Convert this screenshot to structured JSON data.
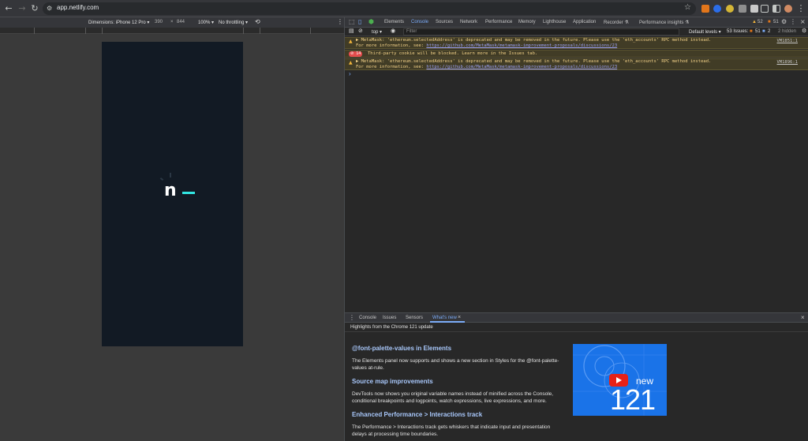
{
  "browser": {
    "url": "app.netlify.com"
  },
  "device_toolbar": {
    "dimensions": "Dimensions: iPhone 12 Pro ▾",
    "width": "390",
    "x": "×",
    "height": "844",
    "zoom": "100% ▾",
    "throttle": "No throttling ▾"
  },
  "devtools": {
    "tabs": [
      "Elements",
      "Console",
      "Sources",
      "Network",
      "Performance",
      "Memory",
      "Lighthouse",
      "Application",
      "Recorder ⚗",
      "Performance insights ⚗"
    ],
    "badges": {
      "warnings": "52",
      "issues": "51"
    },
    "console_toolbar": {
      "context": "top ▾",
      "filter_placeholder": "Filter",
      "levels": "Default levels ▾",
      "issues_label": "53 Issues:",
      "issues_warn": "51",
      "issues_info": "2",
      "hidden": "2 hidden"
    },
    "messages": [
      {
        "line1": "▶ MetaMask: 'ethereum.selectedAddress' is deprecated and may be removed in the future. Please use the 'eth_accounts' RPC method instead.",
        "line2_prefix": "For more information, see: ",
        "link": "https://github.com/MetaMask/metamask-improvement-proposals/discussions/23",
        "source": "VM1851:1"
      },
      {
        "count": "14",
        "line1": "Third-party cookie will be blocked. Learn more in the Issues tab."
      },
      {
        "line1": "▶ MetaMask: 'ethereum.selectedAddress' is deprecated and may be removed in the future. Please use the 'eth_accounts' RPC method instead.",
        "line2_prefix": "For more information, see: ",
        "link": "https://github.com/MetaMask/metamask-improvement-proposals/discussions/23",
        "source": "VM1896:1"
      }
    ],
    "prompt": "›"
  },
  "drawer": {
    "tabs": [
      "Console",
      "Issues",
      "Sensors",
      "What's new"
    ],
    "close": "×",
    "subtitle": "Highlights from the Chrome 121 update",
    "sections": [
      {
        "heading": "@font-palette-values in Elements",
        "body": "The Elements panel now supports and shows a new section in Styles for the @font-palette-values at-rule."
      },
      {
        "heading": "Source map improvements",
        "body": "DevTools now shows you original variable names instead of minified across the Console, conditional breakpoints and logpoints, watch expressions, live expressions, and more."
      },
      {
        "heading": "Enhanced Performance > Interactions track",
        "body": "The Performance > Interactions track gets whiskers that indicate input and presentation delays at processing time boundaries."
      }
    ],
    "promo": {
      "new": "new",
      "version": "121"
    }
  },
  "app": {
    "logo_letter": "n"
  },
  "colors": {
    "accent_link": "#7cacf8",
    "warning_bg": "#413c26",
    "logo_cyan": "#32e6e2",
    "phone_bg": "#121a24",
    "promo_bg": "#1a73e8"
  }
}
